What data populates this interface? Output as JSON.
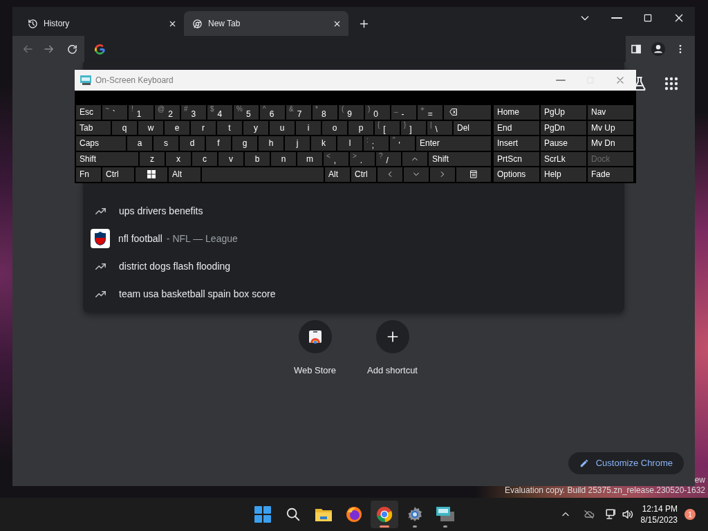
{
  "browser": {
    "tabs": [
      {
        "kind": "history",
        "title": "History",
        "selected": false
      },
      {
        "kind": "chrome",
        "title": "New Tab",
        "selected": true
      }
    ],
    "suggestions": [
      {
        "kind": "trend",
        "text": "ups drivers benefits",
        "selected": false
      },
      {
        "kind": "entity",
        "text": "nfl football",
        "detail": "- NFL — League",
        "selected": false
      },
      {
        "kind": "trend",
        "text": "district dogs flash flooding",
        "selected": false
      },
      {
        "kind": "trend",
        "text": "team usa basketball spain box score",
        "selected": false
      }
    ],
    "shortcuts": [
      {
        "kind": "store",
        "label": "Web Store"
      },
      {
        "kind": "add",
        "label": "Add shortcut"
      }
    ],
    "customize_button": "Customize Chrome"
  },
  "keyboard": {
    "title": "On-Screen Keyboard",
    "rows": [
      [
        {
          "kind": "label",
          "label": "Esc"
        },
        {
          "kind": "pair",
          "shift": "~",
          "label": "`"
        },
        {
          "kind": "pair",
          "shift": "!",
          "label": "1"
        },
        {
          "kind": "pair",
          "shift": "@",
          "label": "2"
        },
        {
          "kind": "pair",
          "shift": "#",
          "label": "3"
        },
        {
          "kind": "pair",
          "shift": "$",
          "label": "4"
        },
        {
          "kind": "pair",
          "shift": "%",
          "label": "5"
        },
        {
          "kind": "pair",
          "shift": "^",
          "label": "6"
        },
        {
          "kind": "pair",
          "shift": "&",
          "label": "7"
        },
        {
          "kind": "pair",
          "shift": "*",
          "label": "8"
        },
        {
          "kind": "pair",
          "shift": "(",
          "label": "9"
        },
        {
          "kind": "pair",
          "shift": ")",
          "label": "0"
        },
        {
          "kind": "pair",
          "shift": "_",
          "label": "-"
        },
        {
          "kind": "pair",
          "shift": "+",
          "label": "="
        },
        {
          "kind": "backspace"
        }
      ],
      [
        {
          "kind": "label",
          "label": "Tab"
        },
        {
          "kind": "letter",
          "label": "q"
        },
        {
          "kind": "letter",
          "label": "w"
        },
        {
          "kind": "letter",
          "label": "e"
        },
        {
          "kind": "letter",
          "label": "r"
        },
        {
          "kind": "letter",
          "label": "t"
        },
        {
          "kind": "letter",
          "label": "y"
        },
        {
          "kind": "letter",
          "label": "u"
        },
        {
          "kind": "letter",
          "label": "i"
        },
        {
          "kind": "letter",
          "label": "o"
        },
        {
          "kind": "letter",
          "label": "p"
        },
        {
          "kind": "pair",
          "shift": "{",
          "label": "["
        },
        {
          "kind": "pair",
          "shift": "}",
          "label": "]"
        },
        {
          "kind": "pair",
          "shift": "|",
          "label": "\\"
        },
        {
          "kind": "label",
          "label": "Del"
        }
      ],
      [
        {
          "kind": "label",
          "label": "Caps"
        },
        {
          "kind": "letter",
          "label": "a"
        },
        {
          "kind": "letter",
          "label": "s"
        },
        {
          "kind": "letter",
          "label": "d"
        },
        {
          "kind": "letter",
          "label": "f"
        },
        {
          "kind": "letter",
          "label": "g"
        },
        {
          "kind": "letter",
          "label": "h"
        },
        {
          "kind": "letter",
          "label": "j"
        },
        {
          "kind": "letter",
          "label": "k"
        },
        {
          "kind": "letter",
          "label": "l"
        },
        {
          "kind": "pair",
          "shift": ":",
          "label": ";"
        },
        {
          "kind": "pair",
          "shift": "\"",
          "label": "'"
        },
        {
          "kind": "label",
          "label": "Enter"
        }
      ],
      [
        {
          "kind": "label",
          "label": "Shift"
        },
        {
          "kind": "letter",
          "label": "z"
        },
        {
          "kind": "letter",
          "label": "x"
        },
        {
          "kind": "letter",
          "label": "c"
        },
        {
          "kind": "letter",
          "label": "v"
        },
        {
          "kind": "letter",
          "label": "b"
        },
        {
          "kind": "letter",
          "label": "n"
        },
        {
          "kind": "letter",
          "label": "m"
        },
        {
          "kind": "pair",
          "shift": "<",
          "label": ","
        },
        {
          "kind": "pair",
          "shift": ">",
          "label": "."
        },
        {
          "kind": "pair",
          "shift": "?",
          "label": "/"
        },
        {
          "kind": "up"
        },
        {
          "kind": "label",
          "label": "Shift"
        }
      ],
      [
        {
          "kind": "label",
          "label": "Fn"
        },
        {
          "kind": "label",
          "label": "Ctrl"
        },
        {
          "kind": "windows"
        },
        {
          "kind": "label",
          "label": "Alt"
        },
        {
          "kind": "space"
        },
        {
          "kind": "label",
          "label": "Alt"
        },
        {
          "kind": "label",
          "label": "Ctrl"
        },
        {
          "kind": "left"
        },
        {
          "kind": "down"
        },
        {
          "kind": "right"
        },
        {
          "kind": "menu"
        }
      ]
    ],
    "side_rows": [
      [
        {
          "label": "Home",
          "disabled": false
        },
        {
          "label": "PgUp",
          "disabled": false
        },
        {
          "label": "Nav",
          "disabled": false
        }
      ],
      [
        {
          "label": "End",
          "disabled": false
        },
        {
          "label": "PgDn",
          "disabled": false
        },
        {
          "label": "Mv Up",
          "disabled": false
        }
      ],
      [
        {
          "label": "Insert",
          "disabled": false
        },
        {
          "label": "Pause",
          "disabled": false
        },
        {
          "label": "Mv Dn",
          "disabled": false
        }
      ],
      [
        {
          "label": "PrtScn",
          "disabled": false
        },
        {
          "label": "ScrLk",
          "disabled": false
        },
        {
          "label": "Dock",
          "disabled": true
        }
      ],
      [
        {
          "label": "Options",
          "disabled": false
        },
        {
          "label": "Help",
          "disabled": false
        },
        {
          "label": "Fade",
          "disabled": false
        }
      ]
    ]
  },
  "desktop": {
    "text_fragment": "ew",
    "build_text": "Evaluation copy. Build 25375.zn_release.230520-1632"
  },
  "taskbar": {
    "apps": [
      {
        "kind": "start",
        "selected": false,
        "open": false
      },
      {
        "kind": "search",
        "selected": false,
        "open": false
      },
      {
        "kind": "folder",
        "selected": false,
        "open": false
      },
      {
        "kind": "firefox",
        "selected": false,
        "open": false
      },
      {
        "kind": "chrome",
        "selected": true,
        "open": true
      },
      {
        "kind": "settings",
        "selected": false,
        "open": true
      },
      {
        "kind": "keyboard",
        "selected": false,
        "open": true
      }
    ],
    "time": "12:14 PM",
    "date": "8/15/2023",
    "notification_count": "1"
  }
}
